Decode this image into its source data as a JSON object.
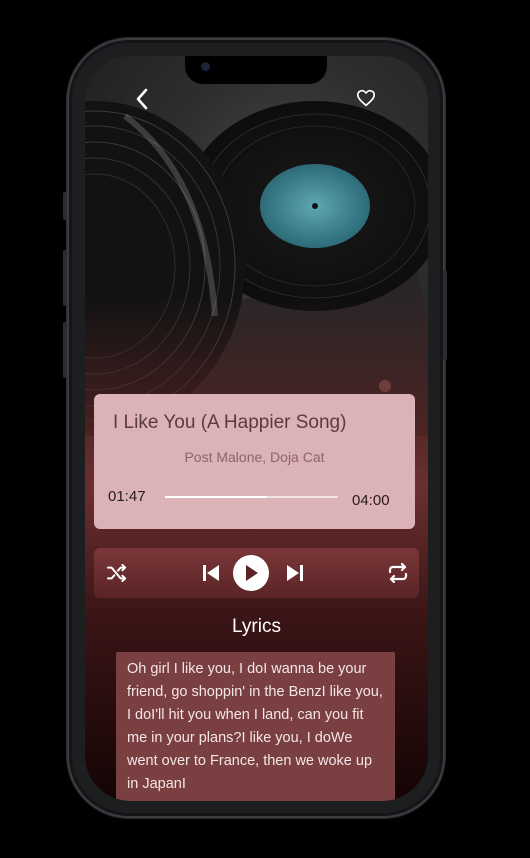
{
  "player": {
    "title": "I Like You (A Happier Song)",
    "artist": "Post Malone, Doja Cat",
    "current_time": "01:47",
    "total_time": "04:00",
    "progress": 0.59
  },
  "lyrics": {
    "heading": "Lyrics",
    "text": "Oh girl I like you, I doI wanna be your friend, go shoppin' in the BenzI like you, I doI'll hit you when I land, can you fit me in your plans?I like you, I doWe went over to France, then we woke up in JapanI"
  },
  "icons": {
    "back": "chevron-left",
    "favorite": "heart-outline",
    "shuffle": "shuffle",
    "previous": "skip-previous",
    "play": "play",
    "next": "skip-next",
    "repeat": "repeat"
  },
  "colors": {
    "card": "#dbb2b5",
    "controls": "#6e2f31",
    "lyrics_box": "#7a3f41",
    "background": "#1a0607"
  }
}
